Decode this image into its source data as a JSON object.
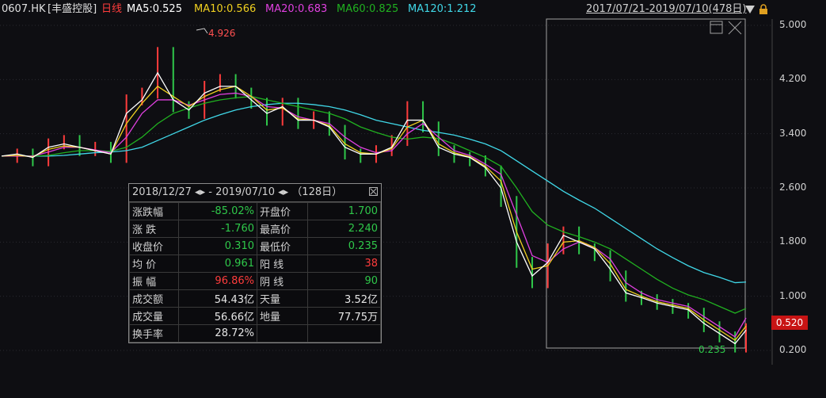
{
  "header": {
    "code": "0607.HK",
    "name": "[丰盛控股]",
    "period": "日线",
    "ma5": "MA5:0.525",
    "ma10": "MA10:0.566",
    "ma20": "MA20:0.683",
    "ma60": "MA60:0.825",
    "ma120": "MA120:1.212",
    "range": "2017/07/21-2019/07/10(478日)"
  },
  "colors": {
    "ma5": "#ffffff",
    "ma10": "#f0d020",
    "ma20": "#e040e0",
    "ma60": "#20b020",
    "ma120": "#40d8e8",
    "up": "#ff3c3c",
    "down": "#2fc84a",
    "bg": "#0e0e12"
  },
  "price_tag": "0.520",
  "stats": {
    "title": "2018/12/27 ◂▸ - 2019/07/10 ◂▸ （128日）",
    "rows": [
      {
        "k1": "涨跌幅",
        "v1": "-85.02%",
        "c1": "down",
        "k2": "开盘价",
        "v2": "1.700",
        "c2": "down"
      },
      {
        "k1": "涨 跌",
        "v1": "-1.760",
        "c1": "down",
        "k2": "最高价",
        "v2": "2.240",
        "c2": "down"
      },
      {
        "k1": "收盘价",
        "v1": "0.310",
        "c1": "down",
        "k2": "最低价",
        "v2": "0.235",
        "c2": "down"
      },
      {
        "k1": "均 价",
        "v1": "0.961",
        "c1": "down",
        "k2": "阳 线",
        "v2": "38",
        "c2": "up"
      },
      {
        "k1": "振 幅",
        "v1": "96.86%",
        "c1": "up",
        "k2": "阴 线",
        "v2": "90",
        "c2": "down"
      },
      {
        "k1": "成交额",
        "v1": "54.43亿",
        "c1": "neu",
        "k2": "天量",
        "v2": "3.52亿",
        "c2": "neu"
      },
      {
        "k1": "成交量",
        "v1": "56.66亿",
        "c1": "neu",
        "k2": "地量",
        "v2": "77.75万",
        "c2": "neu"
      },
      {
        "k1": "换手率",
        "v1": "28.72%",
        "c1": "neu",
        "k2": "",
        "v2": "",
        "c2": "neu"
      }
    ]
  },
  "chart_data": {
    "type": "line",
    "title": "0607.HK [丰盛控股] 日线",
    "y_ticks": [
      "5.000",
      "4.200",
      "3.400",
      "2.600",
      "1.800",
      "1.000",
      "0.200"
    ],
    "y_tick_values": [
      5.0,
      4.2,
      3.4,
      2.6,
      1.8,
      1.0,
      0.2
    ],
    "ylim": [
      0.2,
      5.0
    ],
    "annotations": {
      "high": "4.926",
      "low": "0.235"
    },
    "x": [
      0,
      10,
      20,
      30,
      40,
      50,
      60,
      70,
      80,
      90,
      100,
      110,
      120,
      130,
      140,
      150,
      160,
      170,
      180,
      190,
      200,
      210,
      220,
      230,
      240,
      250,
      260,
      270,
      280,
      290,
      300,
      310,
      320,
      330,
      340,
      350,
      360,
      370,
      380,
      390,
      400,
      410,
      420,
      430,
      440,
      450,
      460,
      470,
      477
    ],
    "series": [
      {
        "name": "MA5:0.525",
        "key": "ma5",
        "values": [
          3.07,
          3.1,
          3.05,
          3.2,
          3.25,
          3.2,
          3.15,
          3.1,
          3.7,
          3.9,
          4.3,
          3.9,
          3.75,
          4.0,
          4.1,
          4.1,
          3.9,
          3.7,
          3.8,
          3.6,
          3.6,
          3.5,
          3.2,
          3.1,
          3.1,
          3.2,
          3.6,
          3.6,
          3.2,
          3.1,
          3.05,
          2.9,
          2.6,
          1.8,
          1.3,
          1.5,
          1.9,
          1.8,
          1.7,
          1.4,
          1.05,
          0.98,
          0.9,
          0.85,
          0.8,
          0.6,
          0.45,
          0.3,
          0.5
        ]
      },
      {
        "name": "MA10:0.566",
        "key": "ma10",
        "values": [
          3.07,
          3.08,
          3.06,
          3.17,
          3.22,
          3.2,
          3.15,
          3.1,
          3.55,
          3.85,
          4.1,
          3.95,
          3.8,
          3.95,
          4.05,
          4.1,
          3.95,
          3.75,
          3.78,
          3.62,
          3.6,
          3.52,
          3.25,
          3.12,
          3.1,
          3.18,
          3.5,
          3.6,
          3.25,
          3.12,
          3.06,
          2.92,
          2.7,
          1.95,
          1.4,
          1.45,
          1.8,
          1.82,
          1.72,
          1.48,
          1.1,
          1.0,
          0.92,
          0.87,
          0.82,
          0.65,
          0.5,
          0.35,
          0.56
        ]
      },
      {
        "name": "MA20:0.683",
        "key": "ma20",
        "values": [
          3.07,
          3.07,
          3.07,
          3.13,
          3.2,
          3.2,
          3.16,
          3.12,
          3.35,
          3.7,
          3.9,
          3.9,
          3.82,
          3.9,
          3.98,
          4.0,
          3.95,
          3.8,
          3.78,
          3.65,
          3.6,
          3.55,
          3.35,
          3.2,
          3.12,
          3.15,
          3.4,
          3.55,
          3.35,
          3.15,
          3.08,
          2.95,
          2.8,
          2.2,
          1.6,
          1.5,
          1.7,
          1.8,
          1.72,
          1.55,
          1.2,
          1.05,
          0.95,
          0.9,
          0.85,
          0.7,
          0.55,
          0.4,
          0.68
        ]
      },
      {
        "name": "MA60:0.825",
        "key": "ma60",
        "values": [
          3.07,
          3.07,
          3.07,
          3.08,
          3.12,
          3.15,
          3.15,
          3.14,
          3.2,
          3.35,
          3.55,
          3.7,
          3.78,
          3.85,
          3.9,
          3.93,
          3.95,
          3.9,
          3.85,
          3.8,
          3.75,
          3.7,
          3.62,
          3.5,
          3.42,
          3.35,
          3.32,
          3.35,
          3.33,
          3.25,
          3.15,
          3.05,
          2.92,
          2.6,
          2.25,
          2.05,
          1.95,
          1.88,
          1.8,
          1.7,
          1.55,
          1.4,
          1.25,
          1.12,
          1.02,
          0.95,
          0.85,
          0.75,
          0.82
        ]
      },
      {
        "name": "MA120:1.212",
        "key": "ma120",
        "values": [
          3.07,
          3.07,
          3.07,
          3.07,
          3.08,
          3.1,
          3.12,
          3.13,
          3.15,
          3.2,
          3.3,
          3.4,
          3.5,
          3.6,
          3.68,
          3.75,
          3.8,
          3.83,
          3.85,
          3.85,
          3.83,
          3.8,
          3.75,
          3.68,
          3.6,
          3.55,
          3.5,
          3.45,
          3.42,
          3.38,
          3.32,
          3.25,
          3.15,
          3.0,
          2.85,
          2.7,
          2.55,
          2.42,
          2.3,
          2.15,
          2.0,
          1.85,
          1.7,
          1.57,
          1.45,
          1.35,
          1.28,
          1.2,
          1.21
        ]
      }
    ],
    "price": {
      "name": "",
      "key": "price",
      "values": [
        3.05,
        3.1,
        3.0,
        3.25,
        3.3,
        3.15,
        3.2,
        3.05,
        3.9,
        4.0,
        4.6,
        3.8,
        3.7,
        4.1,
        4.2,
        4.0,
        3.85,
        3.6,
        3.85,
        3.55,
        3.65,
        3.45,
        3.1,
        3.05,
        3.15,
        3.3,
        3.8,
        3.5,
        3.15,
        3.05,
        3.0,
        2.85,
        2.4,
        1.5,
        1.2,
        1.7,
        1.95,
        1.7,
        1.6,
        1.3,
        1.0,
        0.95,
        0.88,
        0.82,
        0.75,
        0.55,
        0.4,
        0.25,
        0.52
      ]
    }
  }
}
